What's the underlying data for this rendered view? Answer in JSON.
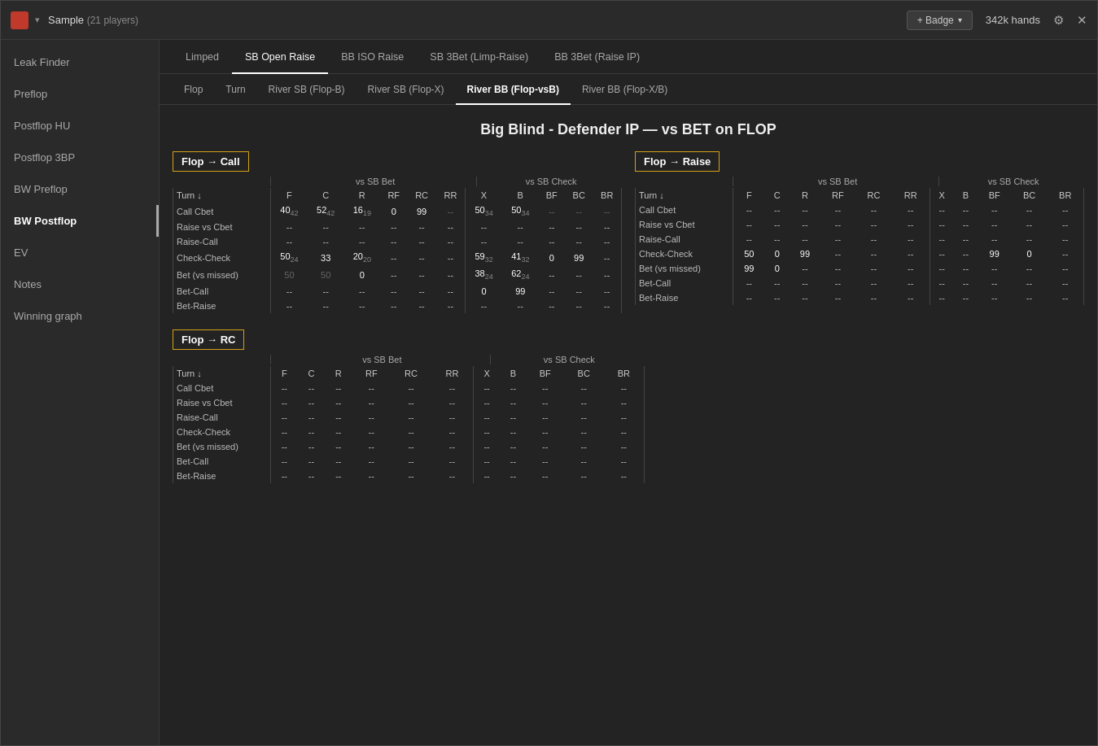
{
  "titleBar": {
    "appName": "Sample",
    "playerCount": "(21 players)",
    "badgeLabel": "+ Badge",
    "handsCount": "342k hands"
  },
  "sidebar": {
    "items": [
      {
        "label": "Leak Finder",
        "active": false
      },
      {
        "label": "Preflop",
        "active": false
      },
      {
        "label": "Postflop HU",
        "active": false
      },
      {
        "label": "Postflop 3BP",
        "active": false
      },
      {
        "label": "BW Preflop",
        "active": false
      },
      {
        "label": "BW Postflop",
        "active": true
      },
      {
        "label": "EV",
        "active": false
      },
      {
        "label": "Notes",
        "active": false
      },
      {
        "label": "Winning graph",
        "active": false
      }
    ]
  },
  "tabs1": [
    {
      "label": "Limped",
      "active": false
    },
    {
      "label": "SB Open Raise",
      "active": true
    },
    {
      "label": "BB ISO Raise",
      "active": false
    },
    {
      "label": "SB 3Bet (Limp-Raise)",
      "active": false
    },
    {
      "label": "BB 3Bet (Raise IP)",
      "active": false
    }
  ],
  "tabs2": [
    {
      "label": "Flop",
      "active": false
    },
    {
      "label": "Turn",
      "active": false
    },
    {
      "label": "River SB (Flop-B)",
      "active": false
    },
    {
      "label": "River SB (Flop-X)",
      "active": false
    },
    {
      "label": "River BB (Flop-vsB)",
      "active": true
    },
    {
      "label": "River BB (Flop-X/B)",
      "active": false
    }
  ],
  "pageHeading": "Big Blind - Defender IP — vs BET on FLOP",
  "sections": {
    "flopCall": {
      "header": "Flop → Call",
      "subHeaders": {
        "vsSBBet": "vs SB Bet",
        "vsSBCheck": "vs SB Check"
      },
      "turnLabel": "Turn ↓",
      "colHeaders1": [
        "F",
        "C",
        "R",
        "RF",
        "RC",
        "RR",
        "X",
        "B",
        "BF",
        "BC",
        "BR"
      ],
      "rows": [
        {
          "label": "Call Cbet",
          "bet": [
            "40",
            "52",
            "16",
            "0",
            "99",
            "--",
            "50",
            "50",
            "--",
            "--",
            "--"
          ],
          "betSub": [
            "42",
            "42",
            "19",
            "",
            "",
            "",
            "34",
            "34",
            "",
            "",
            ""
          ]
        },
        {
          "label": "Raise vs Cbet",
          "bet": [
            "--",
            "--",
            "--",
            "--",
            "--",
            "--",
            "--",
            "--",
            "--",
            "--",
            "--"
          ],
          "betSub": []
        },
        {
          "label": "Raise-Call",
          "bet": [
            "--",
            "--",
            "--",
            "--",
            "--",
            "--",
            "--",
            "--",
            "--",
            "--",
            "--"
          ],
          "betSub": []
        },
        {
          "label": "Check-Check",
          "bet": [
            "50",
            "33",
            "20",
            "--",
            "--",
            "--",
            "59",
            "41",
            "0",
            "99",
            "--"
          ],
          "betSub": [
            "24",
            "",
            "20",
            "",
            "",
            "",
            "32",
            "32",
            "",
            "",
            ""
          ]
        },
        {
          "label": "Bet (vs missed)",
          "bet": [
            "50",
            "50",
            "0",
            "--",
            "--",
            "--",
            "38",
            "62",
            "--",
            "--",
            "--"
          ],
          "betSub": [
            "",
            "",
            "",
            "",
            "",
            "",
            "24",
            "24",
            "",
            "",
            ""
          ]
        },
        {
          "label": "Bet-Call",
          "bet": [
            "--",
            "--",
            "--",
            "--",
            "--",
            "--",
            "0",
            "99",
            "--",
            "--",
            "--"
          ],
          "betSub": []
        },
        {
          "label": "Bet-Raise",
          "bet": [
            "--",
            "--",
            "--",
            "--",
            "--",
            "--",
            "--",
            "--",
            "--",
            "--",
            "--"
          ],
          "betSub": []
        }
      ]
    },
    "flopRaise": {
      "header": "Flop → Raise",
      "turnLabel": "Turn ↓",
      "colHeaders1": [
        "F",
        "C",
        "R",
        "RF",
        "RC",
        "RR",
        "X",
        "B",
        "BF",
        "BC",
        "BR"
      ],
      "rows": [
        {
          "label": "Call Cbet",
          "bet": [
            "--",
            "--",
            "--",
            "--",
            "--",
            "--",
            "--",
            "--",
            "--",
            "--",
            "--"
          ]
        },
        {
          "label": "Raise vs Cbet",
          "bet": [
            "--",
            "--",
            "--",
            "--",
            "--",
            "--",
            "--",
            "--",
            "--",
            "--",
            "--"
          ]
        },
        {
          "label": "Raise-Call",
          "bet": [
            "--",
            "--",
            "--",
            "--",
            "--",
            "--",
            "--",
            "--",
            "--",
            "--",
            "--"
          ]
        },
        {
          "label": "Check-Check",
          "bet": [
            "50",
            "0",
            "99",
            "--",
            "--",
            "--",
            "--",
            "--",
            "99",
            "0",
            "--"
          ]
        },
        {
          "label": "Bet (vs missed)",
          "bet": [
            "99",
            "0",
            "--",
            "--",
            "--",
            "--",
            "--",
            "--",
            "--",
            "--",
            "--"
          ]
        },
        {
          "label": "Bet-Call",
          "bet": [
            "--",
            "--",
            "--",
            "--",
            "--",
            "--",
            "--",
            "--",
            "--",
            "--",
            "--"
          ]
        },
        {
          "label": "Bet-Raise",
          "bet": [
            "--",
            "--",
            "--",
            "--",
            "--",
            "--",
            "--",
            "--",
            "--",
            "--",
            "--"
          ]
        }
      ]
    },
    "flopRC": {
      "header": "Flop → RC",
      "turnLabel": "Turn ↓",
      "colHeaders1": [
        "F",
        "C",
        "R",
        "RF",
        "RC",
        "RR",
        "X",
        "B",
        "BF",
        "BC",
        "BR"
      ],
      "rows": [
        {
          "label": "Call Cbet",
          "bet": [
            "--",
            "--",
            "--",
            "--",
            "--",
            "--",
            "--",
            "--",
            "--",
            "--",
            "--"
          ]
        },
        {
          "label": "Raise vs Cbet",
          "bet": [
            "--",
            "--",
            "--",
            "--",
            "--",
            "--",
            "--",
            "--",
            "--",
            "--",
            "--"
          ]
        },
        {
          "label": "Raise-Call",
          "bet": [
            "--",
            "--",
            "--",
            "--",
            "--",
            "--",
            "--",
            "--",
            "--",
            "--",
            "--"
          ]
        },
        {
          "label": "Check-Check",
          "bet": [
            "--",
            "--",
            "--",
            "--",
            "--",
            "--",
            "--",
            "--",
            "--",
            "--",
            "--"
          ]
        },
        {
          "label": "Bet (vs missed)",
          "bet": [
            "--",
            "--",
            "--",
            "--",
            "--",
            "--",
            "--",
            "--",
            "--",
            "--",
            "--"
          ]
        },
        {
          "label": "Bet-Call",
          "bet": [
            "--",
            "--",
            "--",
            "--",
            "--",
            "--",
            "--",
            "--",
            "--",
            "--",
            "--"
          ]
        },
        {
          "label": "Bet-Raise",
          "bet": [
            "--",
            "--",
            "--",
            "--",
            "--",
            "--",
            "--",
            "--",
            "--",
            "--",
            "--"
          ]
        }
      ]
    }
  }
}
